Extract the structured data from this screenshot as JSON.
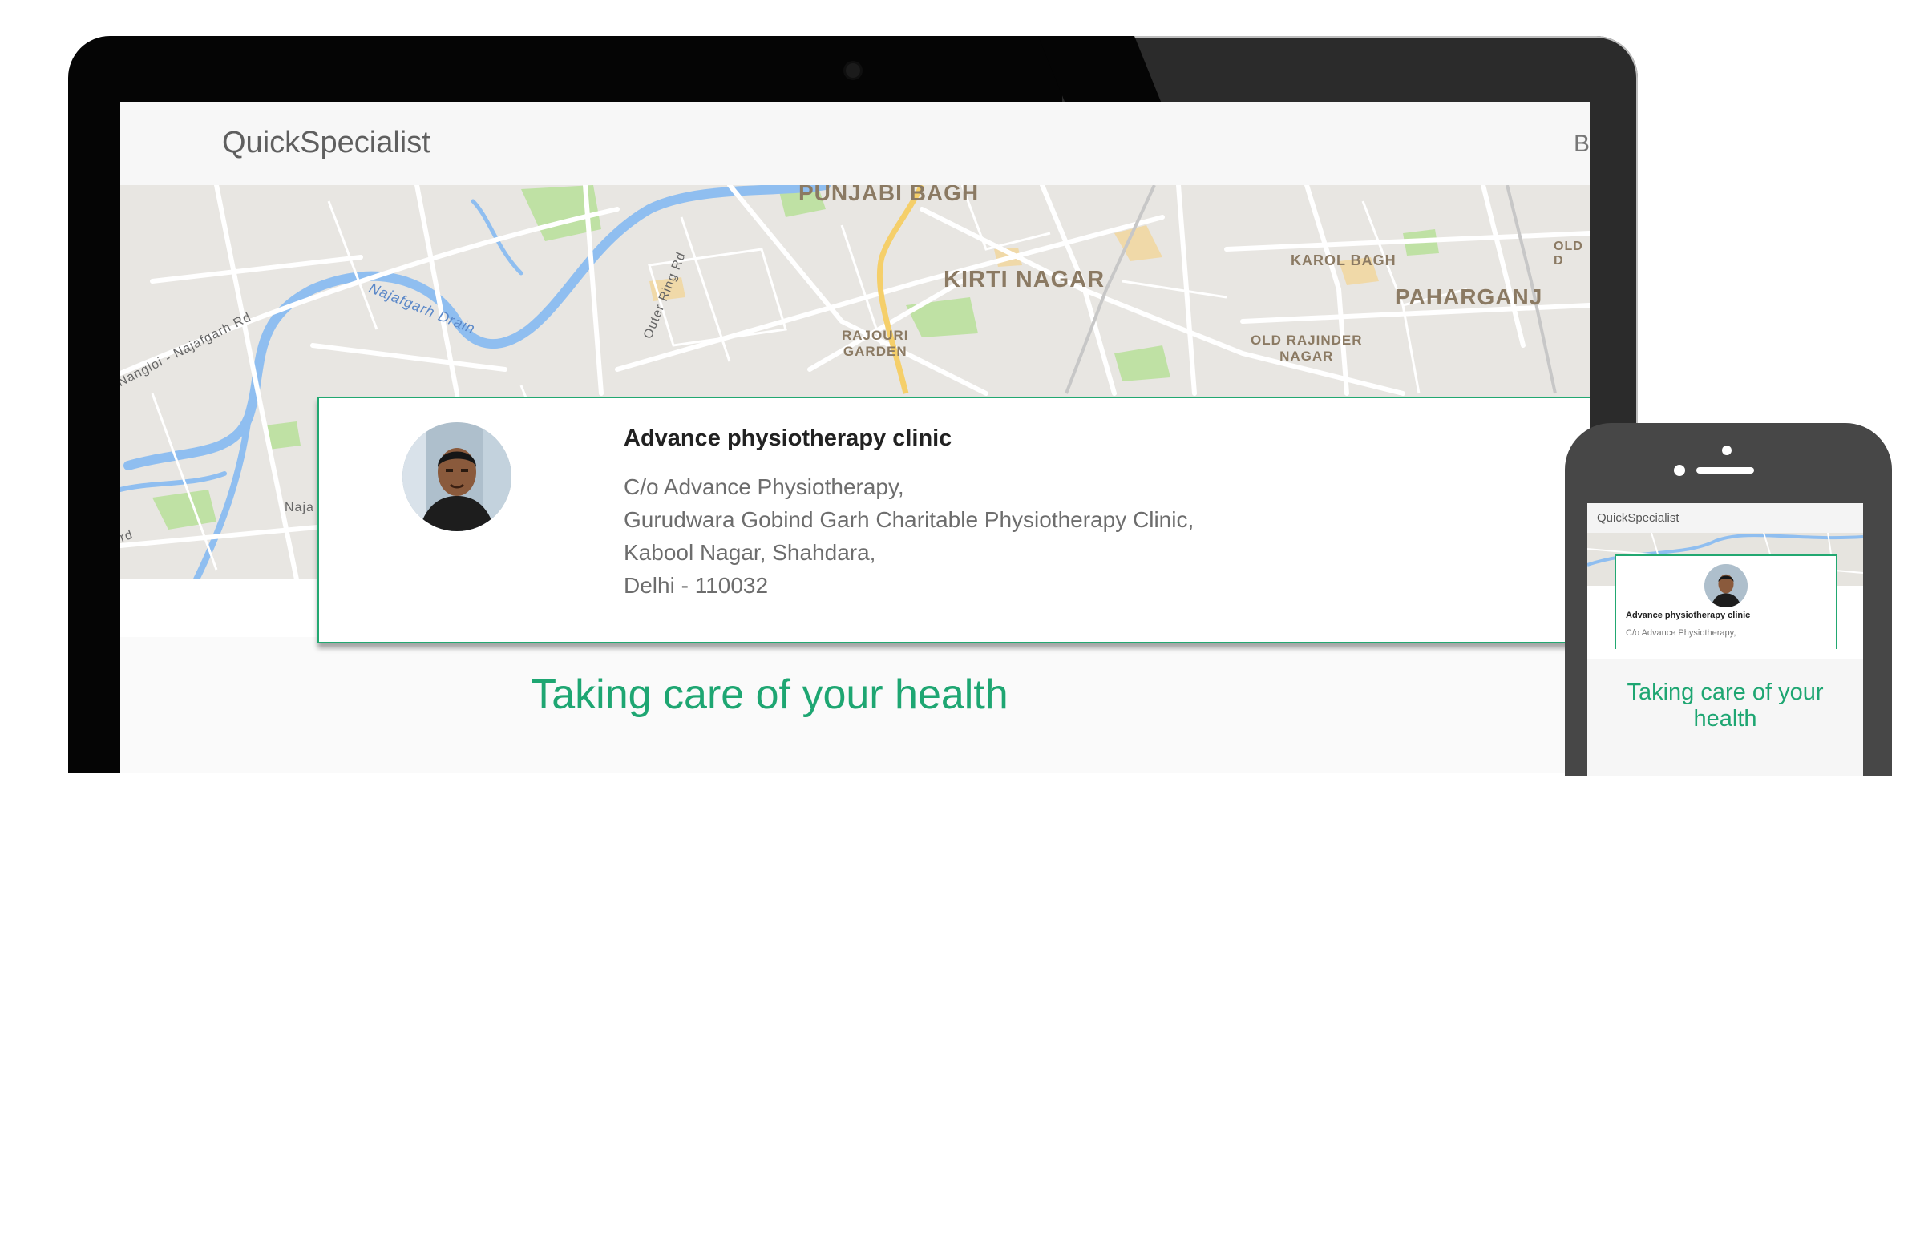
{
  "app": {
    "brand": "QuickSpecialist",
    "appbar_cut_text": "B"
  },
  "map": {
    "labels": {
      "punjabi_bagh": "PUNJABI BAGH",
      "kirti_nagar": "KIRTI NAGAR",
      "karol_bagh": "KAROL BAGH",
      "paharganj": "PAHARGANJ",
      "old_d": "OLD D",
      "rajouri_garden_1": "RAJOURI",
      "rajouri_garden_2": "GARDEN",
      "old_rajinder_1": "OLD RAJINDER",
      "old_rajinder_2": "NAGAR",
      "najafgarh_drain": "Najafgarh Drain",
      "outer_ring_rd": "Outer Ring Rd",
      "nangloi_rd": "Nangloi - Najafgarh Rd",
      "naja": "Naja",
      "rd": "rd"
    }
  },
  "clinic": {
    "name": "Advance physiotherapy clinic",
    "address": [
      "C/o Advance Physiotherapy,",
      "Gurudwara Gobind Garh Charitable Physiotherapy Clinic,",
      "Kabool Nagar, Shahdara,",
      "Delhi - 110032"
    ]
  },
  "tagline": "Taking care of your health",
  "phone": {
    "brand": "QuickSpecialist",
    "clinic_name": "Advance physiotherapy clinic",
    "address_line": "C/o Advance Physiotherapy,",
    "tagline_line1": "Taking care of your",
    "tagline_line2": "health"
  },
  "colors": {
    "accent": "#1ea672",
    "card_border": "#22a871",
    "water": "#8fbef0",
    "park": "#bfe1a4"
  }
}
